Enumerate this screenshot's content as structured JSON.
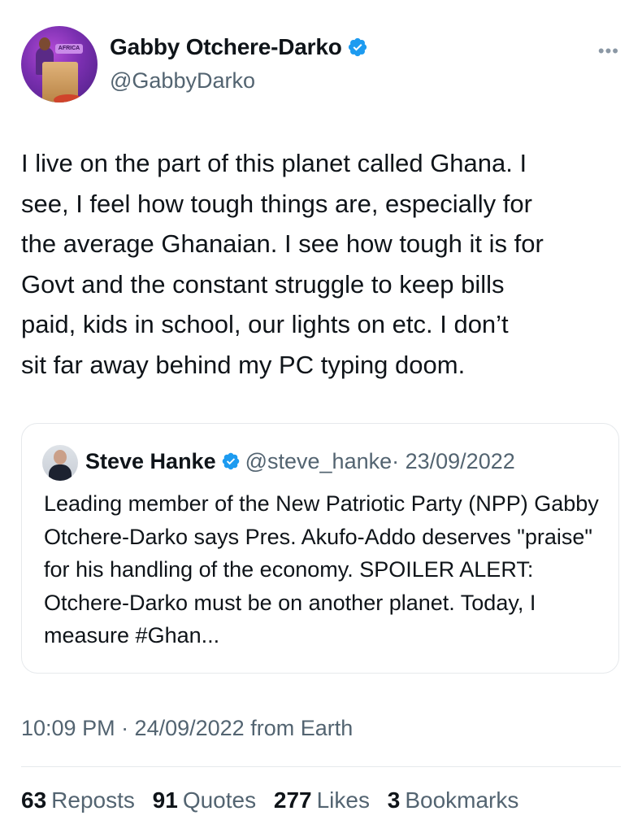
{
  "author": {
    "display_name": "Gabby Otchere-Darko",
    "handle": "@GabbyDarko",
    "avatar_sign": "AFRICA"
  },
  "more_icon": "more-horizontal-icon",
  "tweet": {
    "text": "I live on the part of this planet called Ghana. I\nsee, I feel how tough things are, especially for\nthe average Ghanaian. I see how tough it is for\nGovt and the constant struggle to keep bills\npaid, kids in school, our lights on etc. I don’t\nsit far away behind my PC typing doom."
  },
  "quote": {
    "display_name": "Steve Hanke",
    "handle": "@steve_hanke",
    "date": "· 23/09/2022",
    "text": "Leading member of the New Patriotic Party (NPP) Gabby Otchere-Darko says Pres. Akufo-Addo deserves \"praise\" for his handling of the economy. SPOILER ALERT: Otchere-Darko must be on another planet.  Today, I measure #Ghan..."
  },
  "timestamp": "10:09 PM · 24/09/2022 from Earth",
  "stats": [
    {
      "count": "63",
      "label": "Reposts"
    },
    {
      "count": "91",
      "label": "Quotes"
    },
    {
      "count": "277",
      "label": "Likes"
    },
    {
      "count": "3",
      "label": "Bookmarks"
    }
  ],
  "colors": {
    "verified": "#1d9bf0",
    "secondary_text": "#536471",
    "primary_text": "#0f1419"
  }
}
